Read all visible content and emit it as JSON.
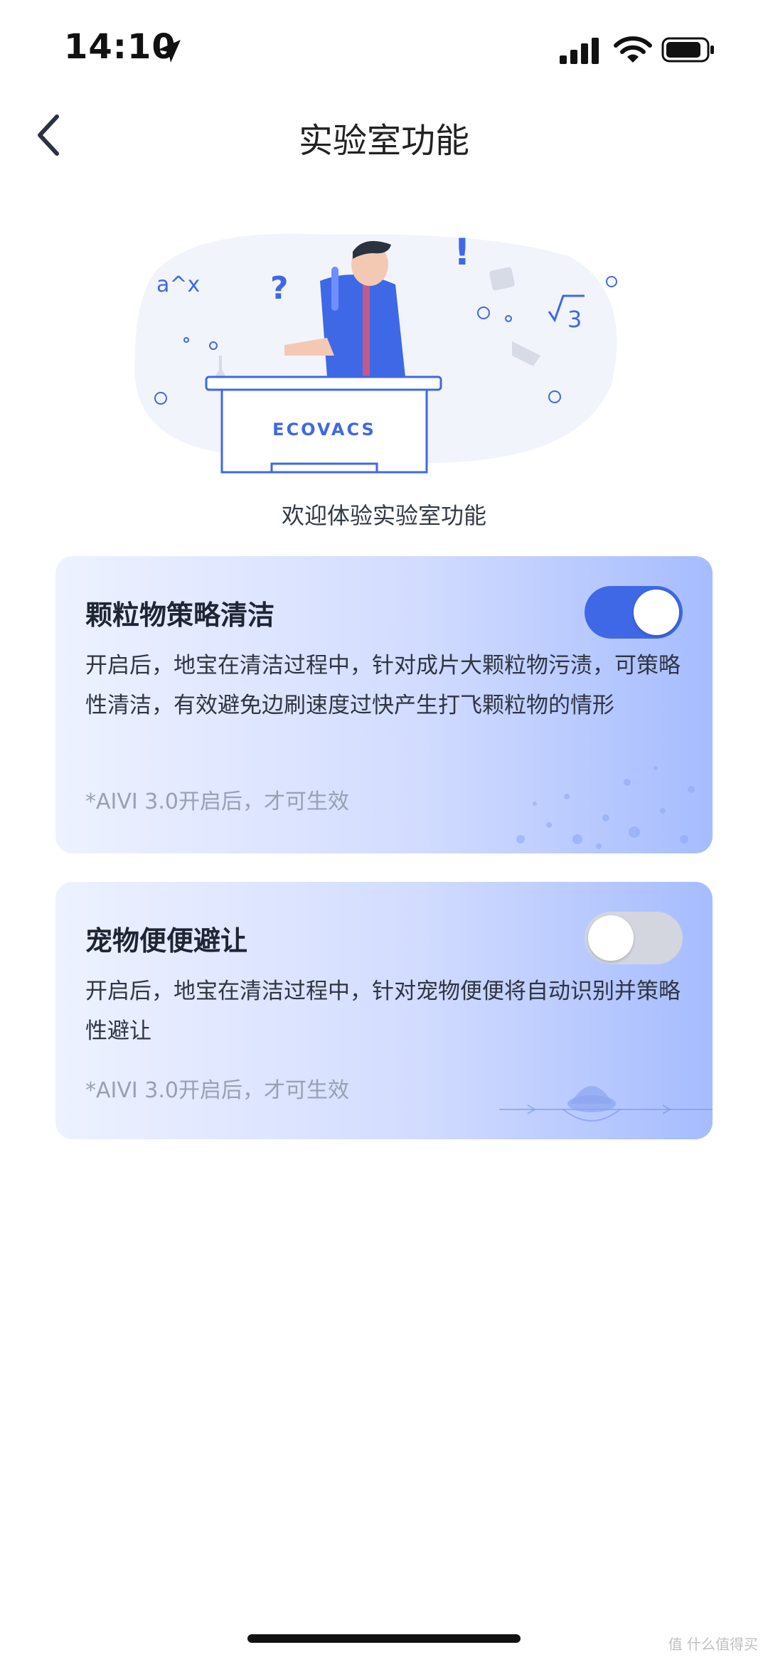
{
  "status_bar": {
    "time": "14:10",
    "icons": [
      "location-arrow-icon",
      "cellular-signal-icon",
      "wifi-icon",
      "battery-icon"
    ]
  },
  "nav": {
    "back_icon": "chevron-left-icon",
    "title": "实验室功能"
  },
  "hero": {
    "logo_text": "ECOVACS",
    "formula_left": "a^x",
    "question_mark": "?",
    "exclaim": "!",
    "sqrt_digit": "3",
    "caption": "欢迎体验实验室功能"
  },
  "cards": [
    {
      "title": "颗粒物策略清洁",
      "description": "开启后，地宝在清洁过程中，针对成片大颗粒物污渍，可策略性清洁，有效避免边刷速度过快产生打飞颗粒物的情形",
      "note": "*AIVI 3.0开启后，才可生效",
      "toggle_on": true
    },
    {
      "title": "宠物便便避让",
      "description": "开启后，地宝在清洁过程中，针对宠物便便将自动识别并策略性避让",
      "note": "*AIVI 3.0开启后，才可生效",
      "toggle_on": false
    }
  ],
  "watermark": "值 什么值得买",
  "colors": {
    "accent": "#3f68e6",
    "toggle_off": "#d3d6df",
    "card_gradient_start": "#eef2ff",
    "card_gradient_end": "#a6bcff",
    "note_gray": "#99a0b3"
  }
}
